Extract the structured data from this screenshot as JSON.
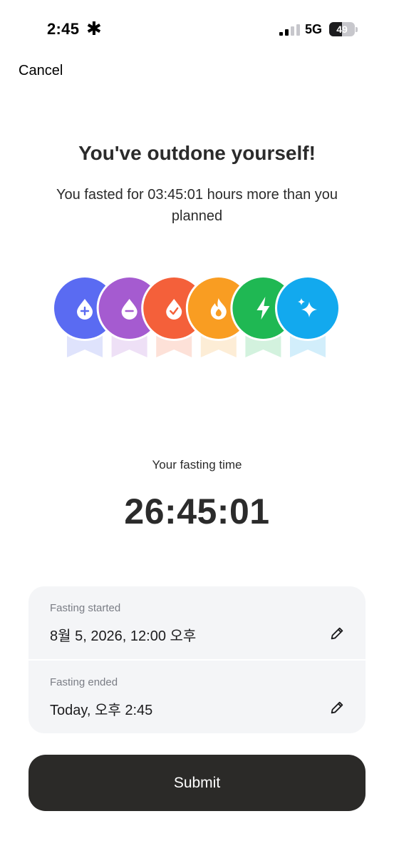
{
  "status_bar": {
    "time": "2:45",
    "activity_symbol": "✱",
    "network": "5G",
    "battery_level": "49"
  },
  "header": {
    "cancel_label": "Cancel"
  },
  "message": {
    "title": "You've outdone yourself!",
    "subtitle": "You fasted for 03:45:01 hours more than you planned"
  },
  "badges": [
    {
      "icon": "drop-plus-icon",
      "color": "#5a6bf2",
      "ribbon": "#dfe3fc"
    },
    {
      "icon": "drop-minus-icon",
      "color": "#a55bd0",
      "ribbon": "#eee0f6"
    },
    {
      "icon": "drop-check-icon",
      "color": "#f4603a",
      "ribbon": "#fde1d8"
    },
    {
      "icon": "flame-icon",
      "color": "#f99d22",
      "ribbon": "#fdedd6"
    },
    {
      "icon": "lightning-icon",
      "color": "#1fb853",
      "ribbon": "#d3f2de"
    },
    {
      "icon": "sparkles-icon",
      "color": "#12a9ee",
      "ribbon": "#d2eefb"
    }
  ],
  "fasting": {
    "label": "Your fasting time",
    "time": "26:45:01"
  },
  "details": {
    "started_label": "Fasting started",
    "started_value": "8월 5, 2026, 12:00 오후",
    "ended_label": "Fasting ended",
    "ended_value": "Today, 오후 2:45"
  },
  "actions": {
    "submit_label": "Submit"
  }
}
